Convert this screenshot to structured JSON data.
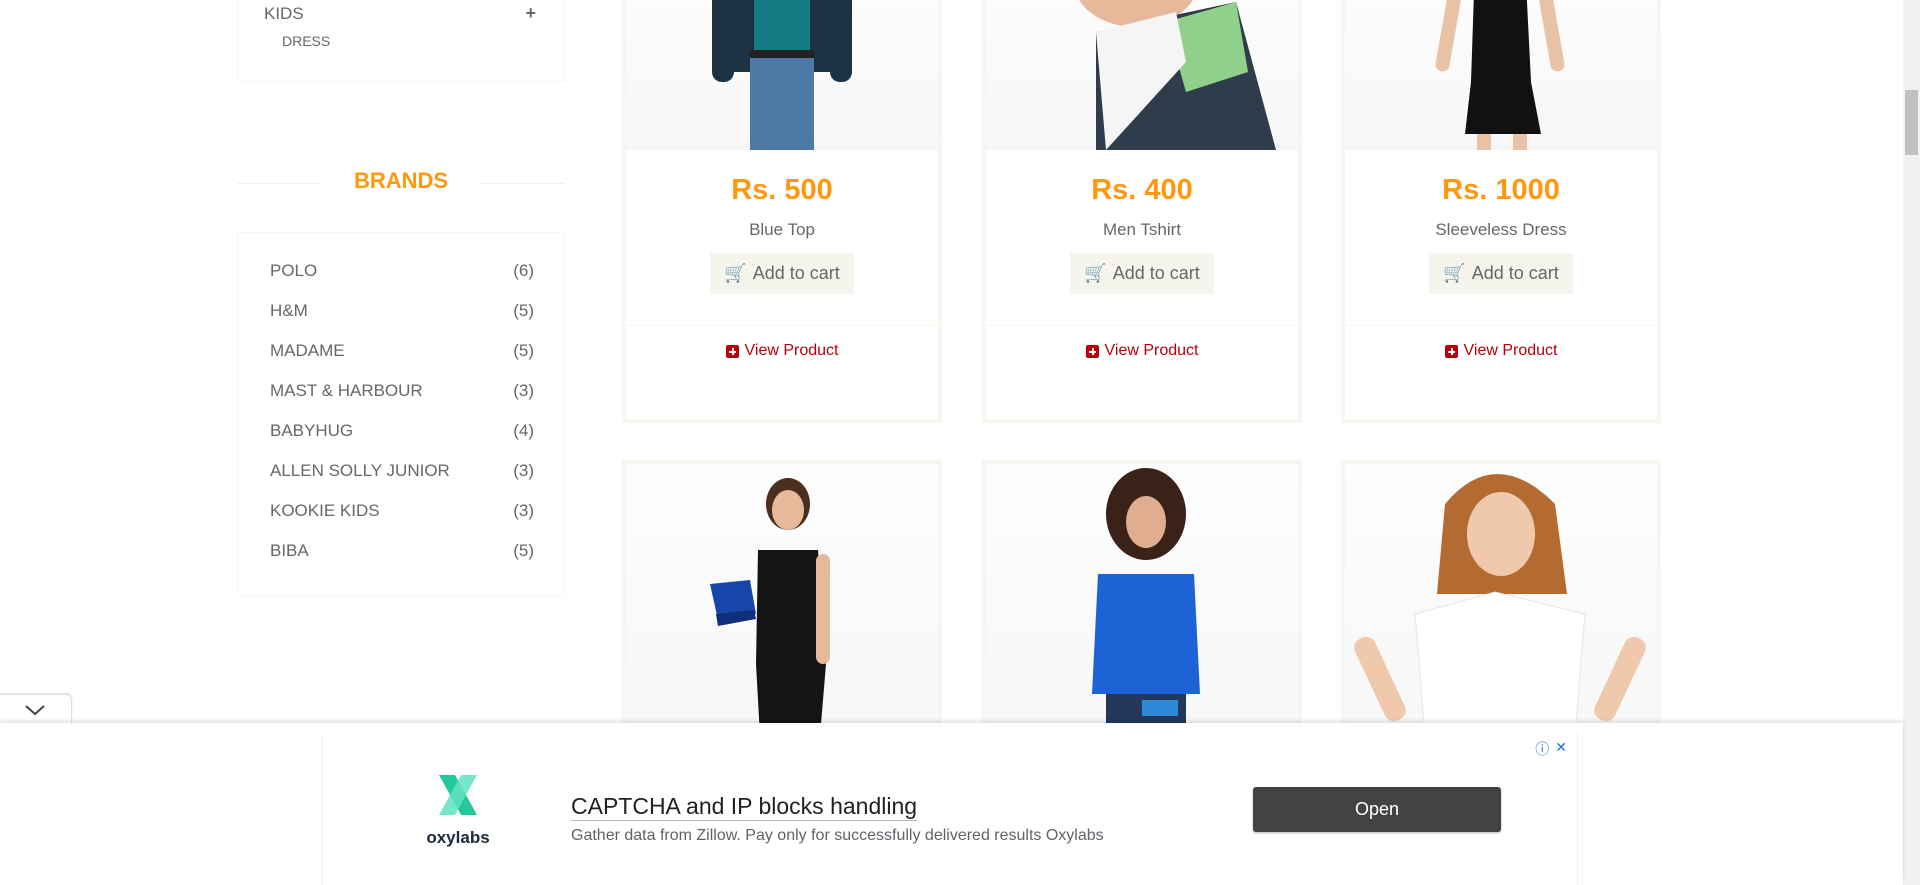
{
  "sidebar": {
    "category": {
      "label": "KIDS",
      "sub_label": "DRESS"
    },
    "brands_title": "BRANDS",
    "brands": [
      {
        "name": "POLO",
        "count": "(6)"
      },
      {
        "name": "H&M",
        "count": "(5)"
      },
      {
        "name": "MADAME",
        "count": "(5)"
      },
      {
        "name": "MAST & HARBOUR",
        "count": "(3)"
      },
      {
        "name": "BABYHUG",
        "count": "(4)"
      },
      {
        "name": "ALLEN SOLLY JUNIOR",
        "count": "(3)"
      },
      {
        "name": "KOOKIE KIDS",
        "count": "(3)"
      },
      {
        "name": "BIBA",
        "count": "(5)"
      }
    ]
  },
  "products": [
    {
      "price": "Rs. 500",
      "name": "Blue Top",
      "add_label": "Add to cart",
      "view_label": "View Product"
    },
    {
      "price": "Rs. 400",
      "name": "Men Tshirt",
      "add_label": "Add to cart",
      "view_label": "View Product"
    },
    {
      "price": "Rs. 1000",
      "name": "Sleeveless Dress",
      "add_label": "Add to cart",
      "view_label": "View Product"
    }
  ],
  "ad": {
    "brand": "oxylabs",
    "title": "CAPTCHA and IP blocks handling",
    "description": "Gather data from Zillow. Pay only for successfully delivered results Oxylabs",
    "open_label": "Open",
    "info_icon": "ⓘ",
    "close_icon": "✕"
  },
  "colors": {
    "accent": "#fe980f",
    "link": "#b3020d",
    "text": "#696763"
  }
}
